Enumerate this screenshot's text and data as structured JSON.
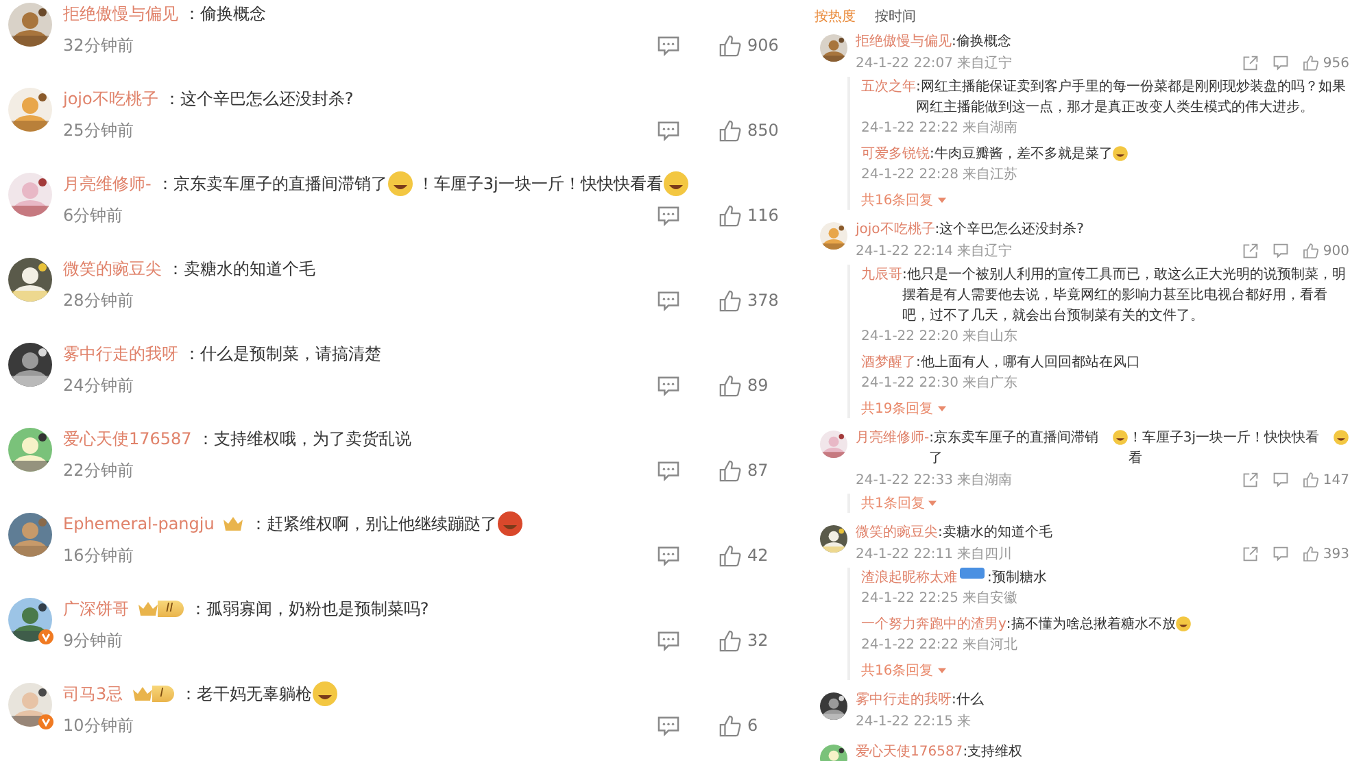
{
  "left_comments": [
    {
      "name": "拒绝傲慢与偏见",
      "crown": false,
      "verified": false,
      "parts": [
        {
          "kind": "text",
          "text": "：偷换概念"
        }
      ],
      "time": "32分钟前",
      "likes": "906"
    },
    {
      "name": "jojo不吃桃子",
      "crown": false,
      "verified": false,
      "parts": [
        {
          "kind": "text",
          "text": "：这个辛巴怎么还没封杀?"
        }
      ],
      "time": "25分钟前",
      "likes": "850"
    },
    {
      "name": "月亮维修师-",
      "crown": false,
      "verified": false,
      "parts": [
        {
          "kind": "text",
          "text": "：京东卖车厘子的直播间滞销了"
        },
        {
          "kind": "emoji",
          "color": "#f3c742"
        },
        {
          "kind": "text",
          "text": "！车厘子3j一块一斤！快快快看看"
        },
        {
          "kind": "emoji",
          "color": "#f3c742"
        }
      ],
      "time": "6分钟前",
      "likes": "116"
    },
    {
      "name": "微笑的豌豆尖",
      "crown": false,
      "verified": false,
      "parts": [
        {
          "kind": "text",
          "text": "：卖糖水的知道个毛"
        }
      ],
      "time": "28分钟前",
      "likes": "378"
    },
    {
      "name": "雾中行走的我呀",
      "crown": false,
      "verified": false,
      "parts": [
        {
          "kind": "text",
          "text": "：什么是预制菜，请搞清楚"
        }
      ],
      "time": "24分钟前",
      "likes": "89"
    },
    {
      "name": "爱心天使176587",
      "crown": false,
      "verified": false,
      "parts": [
        {
          "kind": "text",
          "text": "：支持维权哦，为了卖货乱说"
        }
      ],
      "time": "22分钟前",
      "likes": "87"
    },
    {
      "name": "Ephemeral-pangju",
      "crown": true,
      "verified": false,
      "parts": [
        {
          "kind": "text",
          "text": "：赶紧维权啊，别让他继续蹦跶了"
        },
        {
          "kind": "emoji",
          "color": "#d9482b"
        }
      ],
      "time": "16分钟前",
      "likes": "42"
    },
    {
      "name": "广深饼哥",
      "crown": true,
      "rank_badge": "II",
      "verified": true,
      "parts": [
        {
          "kind": "text",
          "text": "：孤弱寡闻，奶粉也是预制菜吗?"
        }
      ],
      "time": "9分钟前",
      "likes": "32"
    },
    {
      "name": "司马3忌",
      "crown": true,
      "rank_badge": "I",
      "verified": true,
      "parts": [
        {
          "kind": "text",
          "text": "：老干妈无辜躺枪"
        },
        {
          "kind": "emoji",
          "color": "#f3c742"
        }
      ],
      "time": "10分钟前",
      "likes": "6"
    }
  ],
  "right_panel": {
    "tabs": [
      {
        "label": "按热度",
        "selected": true
      },
      {
        "label": "按时间",
        "selected": false
      }
    ],
    "comments": [
      {
        "name": "拒绝傲慢与偏见",
        "parts": [
          {
            "kind": "text",
            "text": ":偷换概念"
          }
        ],
        "meta": "24-1-22 22:07 来自辽宁",
        "likes": "956",
        "replies": [
          {
            "name": "五次之年",
            "parts": [
              {
                "kind": "text",
                "text": ":网红主播能保证卖到客户手里的每一份菜都是刚刚现炒装盘的吗？如果网红主播能做到这一点，那才是真正改变人类生模式的伟大进步。"
              }
            ],
            "meta": "24-1-22 22:22 来自湖南"
          },
          {
            "name": "可爱多锐锐",
            "parts": [
              {
                "kind": "text",
                "text": ":牛肉豆瓣酱，差不多就是菜了"
              },
              {
                "kind": "emoji",
                "color": "#f3c742"
              }
            ],
            "meta": "24-1-22 22:28 来自江苏"
          }
        ],
        "more": "共16条回复"
      },
      {
        "name": "jojo不吃桃子",
        "parts": [
          {
            "kind": "text",
            "text": ":这个辛巴怎么还没封杀?"
          }
        ],
        "meta": "24-1-22 22:14 来自辽宁",
        "likes": "900",
        "replies": [
          {
            "name": "九辰哥",
            "parts": [
              {
                "kind": "text",
                "text": ":他只是一个被别人利用的宣传工具而已，敢这么正大光明的说预制菜，明摆着是有人需要他去说，毕竟网红的影响力甚至比电视台都好用，看看吧，过不了几天，就会出台预制菜有关的文件了。"
              }
            ],
            "meta": "24-1-22 22:20 来自山东"
          },
          {
            "name": "酒梦醒了",
            "parts": [
              {
                "kind": "text",
                "text": ":他上面有人，哪有人回回都站在风口"
              }
            ],
            "meta": "24-1-22 22:30 来自广东"
          }
        ],
        "more": "共19条回复"
      },
      {
        "name": "月亮维修师-",
        "parts": [
          {
            "kind": "text",
            "text": ":京东卖车厘子的直播间滞销了"
          },
          {
            "kind": "emoji",
            "color": "#f3c742"
          },
          {
            "kind": "text",
            "text": "！车厘子3j一块一斤！快快快看看"
          },
          {
            "kind": "emoji",
            "color": "#f3c742"
          }
        ],
        "meta": "24-1-22 22:33 来自湖南",
        "likes": "147",
        "more": "共1条回复"
      },
      {
        "name": "微笑的豌豆尖",
        "parts": [
          {
            "kind": "text",
            "text": ":卖糖水的知道个毛"
          }
        ],
        "meta": "24-1-22 22:11 来自四川",
        "likes": "393",
        "replies": [
          {
            "name": "渣浪起昵称太难",
            "badge": true,
            "parts": [
              {
                "kind": "text",
                "text": ":预制糖水"
              }
            ],
            "meta": "24-1-22 22:25 来自安徽"
          },
          {
            "name": "一个努力奔跑中的渣男y",
            "parts": [
              {
                "kind": "text",
                "text": ":搞不懂为啥总揪着糖水不放"
              },
              {
                "kind": "emoji",
                "color": "#f3c742"
              }
            ],
            "meta": "24-1-22 22:22 来自河北"
          }
        ],
        "more": "共16条回复"
      },
      {
        "name": "雾中行走的我呀",
        "parts": [
          {
            "kind": "text",
            "text": ":什么"
          }
        ],
        "meta": "24-1-22 22:15 来"
      },
      {
        "name": "爱心天使176587",
        "parts": [
          {
            "kind": "text",
            "text": ":支持维权"
          }
        ]
      }
    ]
  }
}
